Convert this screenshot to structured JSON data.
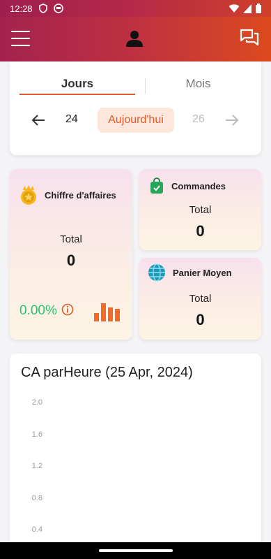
{
  "status_bar": {
    "time": "12:28"
  },
  "tabs": [
    {
      "label": "Jours"
    },
    {
      "label": "Mois"
    }
  ],
  "date_nav": {
    "prev_day": "24",
    "today_label": "Aujourd'hui",
    "next_day": "26"
  },
  "kpis": {
    "chiffre": {
      "title": "Chiffre d'affaires",
      "label": "Total",
      "value": "0",
      "percent": "0.00%"
    },
    "commandes": {
      "title": "Commandes",
      "label": "Total",
      "value": "0"
    },
    "panier": {
      "title": "Panier Moyen",
      "label": "Total",
      "value": "0"
    }
  },
  "chart_data": {
    "type": "line",
    "title": "CA parHeure (25 Apr, 2024)",
    "y_ticks": [
      "2.0",
      "1.6",
      "1.2",
      "0.8",
      "0.4"
    ],
    "series": []
  },
  "colors": {
    "accent": "#e05a2a",
    "positive": "#2fbf71",
    "header_start": "#a3224f",
    "header_end": "#dc4a1e"
  },
  "icons": {
    "menu": "hamburger-icon",
    "user": "user-icon",
    "chat": "chat-icon",
    "prev": "arrow-left-icon",
    "next": "arrow-right-icon",
    "chiffre": "coin-icon",
    "commandes": "shopping-bag-icon",
    "panier": "globe-icon",
    "info": "info-icon",
    "bars": "bar-chart-icon"
  }
}
